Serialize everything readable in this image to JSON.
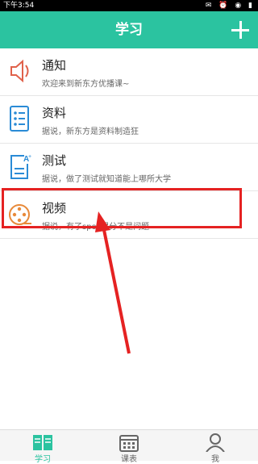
{
  "status_bar": {
    "time": "下午3:54"
  },
  "app_bar": {
    "title": "学习",
    "add_icon": "plus-icon"
  },
  "list": [
    {
      "icon": "speaker-icon",
      "title": "通知",
      "subtitle": "欢迎来到新东方优播课~"
    },
    {
      "icon": "document-list-icon",
      "title": "资料",
      "subtitle": "据说，新东方是资料制造狂"
    },
    {
      "icon": "test-edit-icon",
      "title": "测试",
      "subtitle": "据说，做了测试就知道能上哪所大学"
    },
    {
      "icon": "film-reel-icon",
      "title": "视频",
      "subtitle": "据说，有了spoc提分不是问题"
    }
  ],
  "tabs": [
    {
      "label": "学习",
      "icon": "book-icon",
      "active": true
    },
    {
      "label": "课表",
      "icon": "calendar-icon",
      "active": false
    },
    {
      "label": "我",
      "icon": "person-icon",
      "active": false
    }
  ],
  "colors": {
    "accent": "#2bc3a0",
    "annotation": "#e52222"
  }
}
